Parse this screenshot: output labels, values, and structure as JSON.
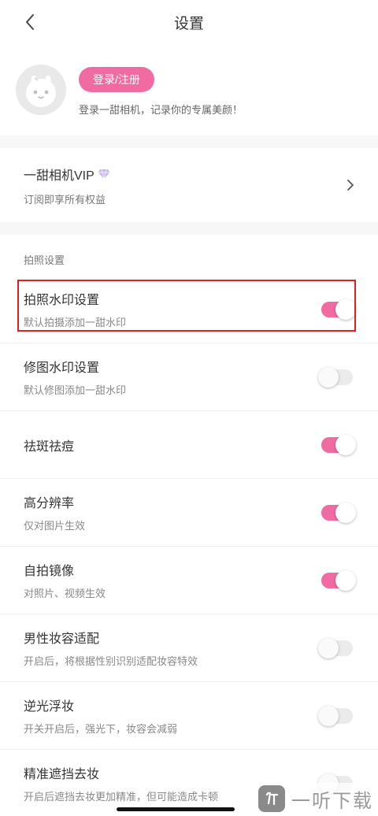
{
  "header": {
    "title": "设置"
  },
  "profile": {
    "login_label": "登录/注册",
    "description": "登录一甜相机，记录你的专属美颜！"
  },
  "vip": {
    "title": "一甜相机VIP",
    "subtitle": "订阅即享所有权益"
  },
  "section": {
    "label": "拍照设置"
  },
  "settings": [
    {
      "title": "拍照水印设置",
      "subtitle": "默认拍摄添加一甜水印",
      "on": true
    },
    {
      "title": "修图水印设置",
      "subtitle": "默认修图添加一甜水印",
      "on": false
    },
    {
      "title": "祛斑祛痘",
      "subtitle": "",
      "on": true
    },
    {
      "title": "高分辨率",
      "subtitle": "仅对图片生效",
      "on": true
    },
    {
      "title": "自拍镜像",
      "subtitle": "对照片、视频生效",
      "on": true
    },
    {
      "title": "男性妆容适配",
      "subtitle": "开启后，将根据性别识别适配妆容特效",
      "on": false
    },
    {
      "title": "逆光浮妆",
      "subtitle": "开关开启后，强光下，妆容会减弱",
      "on": false
    },
    {
      "title": "精准遮挡去妆",
      "subtitle": "开启后遮挡去妆更加精准，但可能造成卡顿",
      "on": false
    }
  ],
  "watermark": {
    "text": "一听下载"
  },
  "colors": {
    "accent": "#f06ba2",
    "highlight": "#e02020"
  }
}
